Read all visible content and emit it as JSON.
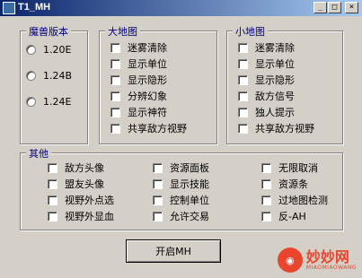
{
  "window": {
    "title": "T1_MH",
    "controls": [
      "_",
      "□",
      "×"
    ]
  },
  "version_group": {
    "title": "魔兽版本",
    "options": [
      "1.20E",
      "1.24B",
      "1.24E"
    ]
  },
  "big_map_group": {
    "title": "大地图",
    "options": [
      "迷雾清除",
      "显示单位",
      "显示隐形",
      "分辨幻象",
      "显示神符",
      "共享敌方视野"
    ]
  },
  "small_map_group": {
    "title": "小地图",
    "options": [
      "迷雾清除",
      "显示单位",
      "显示隐形",
      "敌方信号",
      "独人提示",
      "共享敌方视野"
    ]
  },
  "other_group": {
    "title": "其他",
    "col1": [
      "敌方头像",
      "盟友头像",
      "视野外点选",
      "视野外显血"
    ],
    "col2": [
      "资源面板",
      "显示技能",
      "控制单位",
      "允许交易"
    ],
    "col3": [
      "无限取消",
      "资源条",
      "过地图检测",
      "反-AH"
    ]
  },
  "start_button": {
    "label": "开启MH"
  },
  "watermark": {
    "brand": "妙妙网",
    "domain": "MIAOMIAOWANG"
  }
}
